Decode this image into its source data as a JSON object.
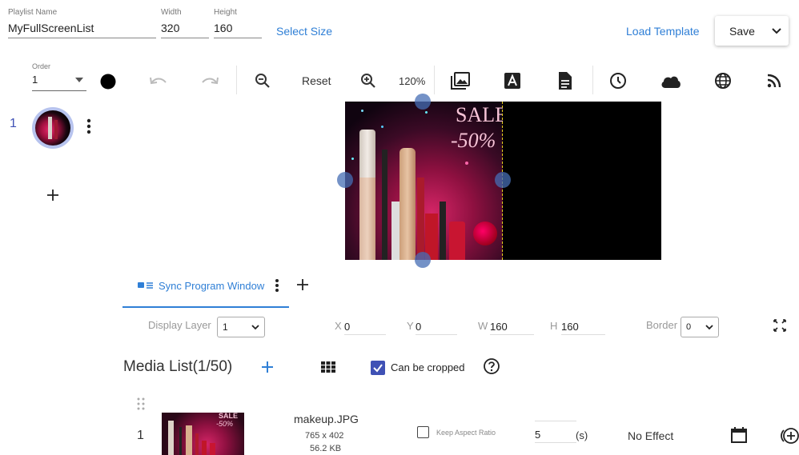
{
  "header": {
    "playlist_name_label": "Playlist Name",
    "playlist_name_value": "MyFullScreenList",
    "width_label": "Width",
    "width_value": "320",
    "height_label": "Height",
    "height_value": "160",
    "select_size": "Select Size",
    "load_template": "Load Template",
    "save_label": "Save"
  },
  "toolbar": {
    "order_label": "Order",
    "order_value": "1",
    "reset_label": "Reset",
    "zoom_value": "120%",
    "icons": [
      "color-dot-icon",
      "undo-icon",
      "redo-icon",
      "zoom-out-icon",
      "zoom-in-icon",
      "image-icon",
      "text-icon",
      "document-icon",
      "clock-icon",
      "cloud-icon",
      "globe-icon",
      "rss-icon"
    ]
  },
  "pages": {
    "items": [
      {
        "number": "1"
      }
    ]
  },
  "preview": {
    "sale_text": "SALE",
    "discount_text": "-50%"
  },
  "window_tab": {
    "label": "Sync Program Window"
  },
  "window_props": {
    "display_layer_label": "Display Layer",
    "display_layer_value": "1",
    "x_label": "X",
    "x_value": "0",
    "y_label": "Y",
    "y_value": "0",
    "w_label": "W",
    "w_value": "160",
    "h_label": "H",
    "h_value": "160",
    "border_label": "Border",
    "border_value": "0"
  },
  "media_list": {
    "title": "Media List(1/50)",
    "can_be_cropped_label": "Can be cropped",
    "can_be_cropped_checked": true,
    "rows": [
      {
        "index": "1",
        "filename": "makeup.JPG",
        "dimensions": "765 x 402",
        "size": "56.2 KB",
        "keep_aspect_label": "Keep Aspect Ratio",
        "duration": "5",
        "duration_unit": "(s)",
        "effect": "No Effect"
      }
    ]
  },
  "colors": {
    "accent": "#2f7fd6",
    "checkbox": "#3f51b5",
    "page_number": "#3f51b5"
  }
}
